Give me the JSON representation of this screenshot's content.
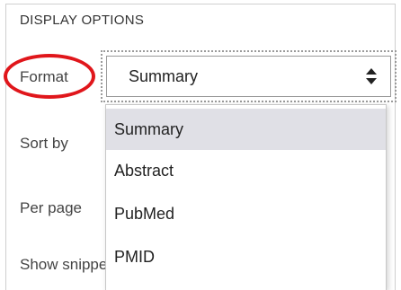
{
  "section": {
    "heading": "DISPLAY OPTIONS"
  },
  "labels": {
    "format": "Format",
    "sort_by": "Sort by",
    "per_page": "Per page",
    "show_snippets": "Show snippets"
  },
  "format_select": {
    "value": "Summary",
    "icon": "sort-arrows-icon",
    "options": [
      "Summary",
      "Abstract",
      "PubMed",
      "PMID"
    ],
    "highlighted_option": "Summary"
  },
  "annotation": {
    "ring_color": "#e0161b"
  }
}
